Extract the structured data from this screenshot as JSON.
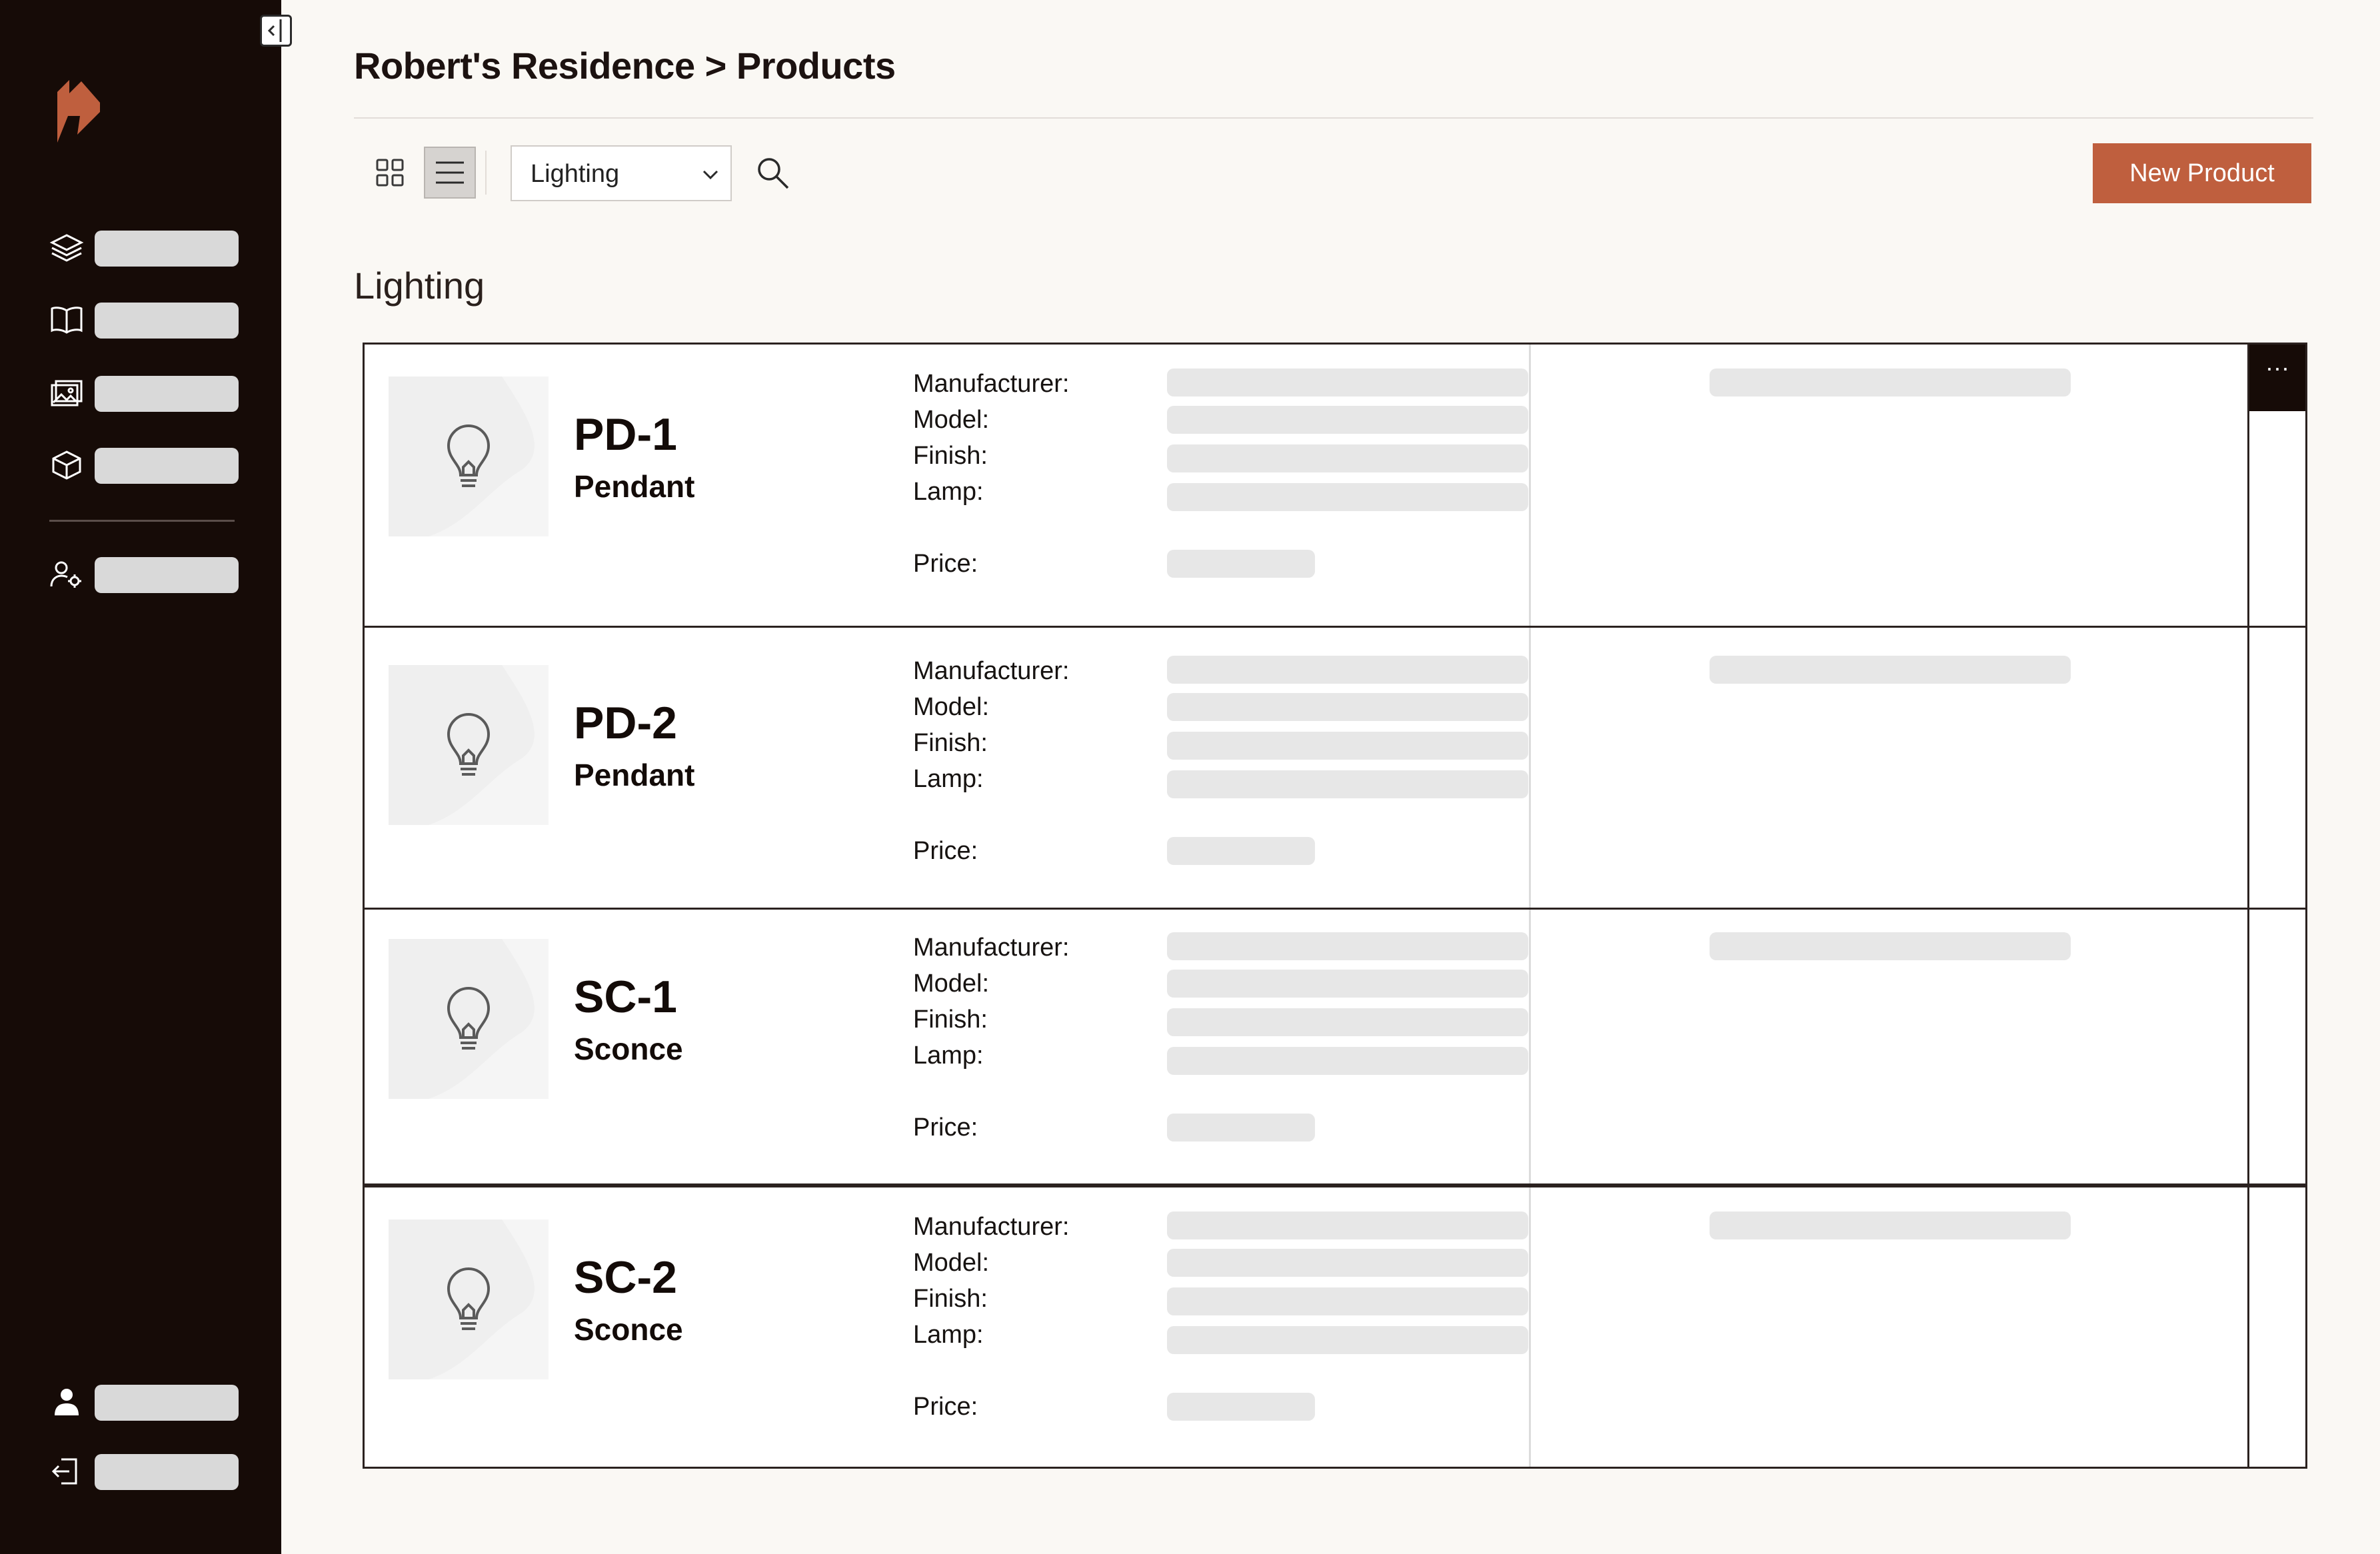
{
  "breadcrumb": "Robert's Residence > Products",
  "toolbar": {
    "filter_value": "Lighting",
    "new_product_label": "New Product"
  },
  "section_title": "Lighting",
  "spec_labels": {
    "manufacturer": "Manufacturer:",
    "model": "Model:",
    "finish": "Finish:",
    "lamp": "Lamp:",
    "price": "Price:"
  },
  "products": [
    {
      "code": "PD-1",
      "type": "Pendant"
    },
    {
      "code": "PD-2",
      "type": "Pendant"
    },
    {
      "code": "SC-1",
      "type": "Sconce"
    },
    {
      "code": "SC-2",
      "type": "Sconce"
    }
  ],
  "row_menu_label": "···",
  "sidebar_icons": [
    "layers-icon",
    "book-icon",
    "image-icon",
    "box-icon",
    "user-settings-icon",
    "user-icon",
    "logout-icon"
  ],
  "colors": {
    "sidebar": "#160b07",
    "accent": "#bf5f3e",
    "background": "#faf8f4"
  }
}
